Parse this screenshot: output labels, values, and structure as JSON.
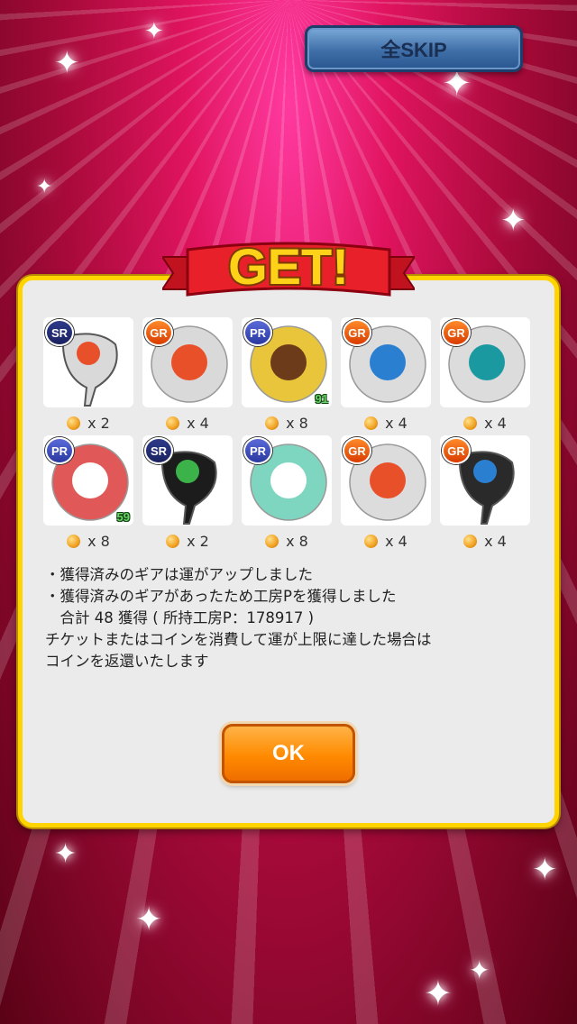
{
  "skip_button": {
    "label": "全SKIP"
  },
  "banner": {
    "text": "GET!"
  },
  "items": [
    {
      "rarity": "SR",
      "kind": "driver",
      "count": "x 2",
      "luck": ""
    },
    {
      "rarity": "GR",
      "kind": "ball",
      "count": "x 4",
      "luck": ""
    },
    {
      "rarity": "PR",
      "kind": "ball",
      "count": "x 8",
      "luck": "91"
    },
    {
      "rarity": "GR",
      "kind": "ball",
      "count": "x 4",
      "luck": ""
    },
    {
      "rarity": "GR",
      "kind": "ball",
      "count": "x 4",
      "luck": ""
    },
    {
      "rarity": "PR",
      "kind": "ball",
      "count": "x 8",
      "luck": "59"
    },
    {
      "rarity": "SR",
      "kind": "driver",
      "count": "x 2",
      "luck": ""
    },
    {
      "rarity": "PR",
      "kind": "ball",
      "count": "x 8",
      "luck": ""
    },
    {
      "rarity": "GR",
      "kind": "ball",
      "count": "x 4",
      "luck": ""
    },
    {
      "rarity": "GR",
      "kind": "driver",
      "count": "x 4",
      "luck": ""
    }
  ],
  "message": {
    "line1": "・獲得済みのギアは運がアップしました",
    "line2": "・獲得済みのギアがあったため工房Pを獲得しました",
    "line3": "　合計 48 獲得 ( 所持工房P：178917 )",
    "line4": "チケットまたはコインを消費して運が上限に達した場合は",
    "line5": "コインを返還いたします"
  },
  "ok_button": {
    "label": "OK"
  },
  "colors": {
    "panel_border": "#ffd400",
    "ok_orange": "#ff8a00",
    "skip_blue": "#3f6fa8"
  }
}
